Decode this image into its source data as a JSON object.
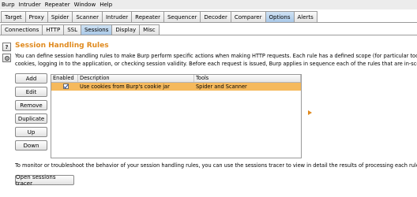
{
  "menubar": [
    "Burp",
    "Intruder",
    "Repeater",
    "Window",
    "Help"
  ],
  "main_tabs": [
    {
      "label": "Target",
      "active": false
    },
    {
      "label": "Proxy",
      "active": false
    },
    {
      "label": "Spider",
      "active": false
    },
    {
      "label": "Scanner",
      "active": false
    },
    {
      "label": "Intruder",
      "active": false
    },
    {
      "label": "Repeater",
      "active": false
    },
    {
      "label": "Sequencer",
      "active": false
    },
    {
      "label": "Decoder",
      "active": false
    },
    {
      "label": "Comparer",
      "active": false
    },
    {
      "label": "Options",
      "active": true
    },
    {
      "label": "Alerts",
      "active": false
    }
  ],
  "sub_tabs": [
    {
      "label": "Connections",
      "active": false
    },
    {
      "label": "HTTP",
      "active": false
    },
    {
      "label": "SSL",
      "active": false
    },
    {
      "label": "Sessions",
      "active": true
    },
    {
      "label": "Display",
      "active": false
    },
    {
      "label": "Misc",
      "active": false
    }
  ],
  "section": {
    "help_icon": "?",
    "title": "Session Handling Rules",
    "description_line1": "You can define session handling rules to make Burp perform specific actions when making HTTP requests. Each rule has a defined scope (for particular tools, URLs or parameters",
    "description_line2": "cookies, logging in to the application, or checking session validity. Before each request is issued, Burp applies in sequence each of the rules that are in-scope for the request."
  },
  "buttons": {
    "add": "Add",
    "edit": "Edit",
    "remove": "Remove",
    "duplicate": "Duplicate",
    "up": "Up",
    "down": "Down",
    "open_tracer": "Open sessions tracer"
  },
  "table": {
    "columns": [
      "Enabled",
      "Description",
      "Tools"
    ],
    "rows": [
      {
        "enabled": true,
        "description": "Use cookies from Burp's cookie jar",
        "tools": "Spider and Scanner"
      }
    ]
  },
  "footer_text": "To monitor or troubleshoot the behavior of your session handling rules, you can use the sessions tracer to view in detail the results of processing each rule."
}
